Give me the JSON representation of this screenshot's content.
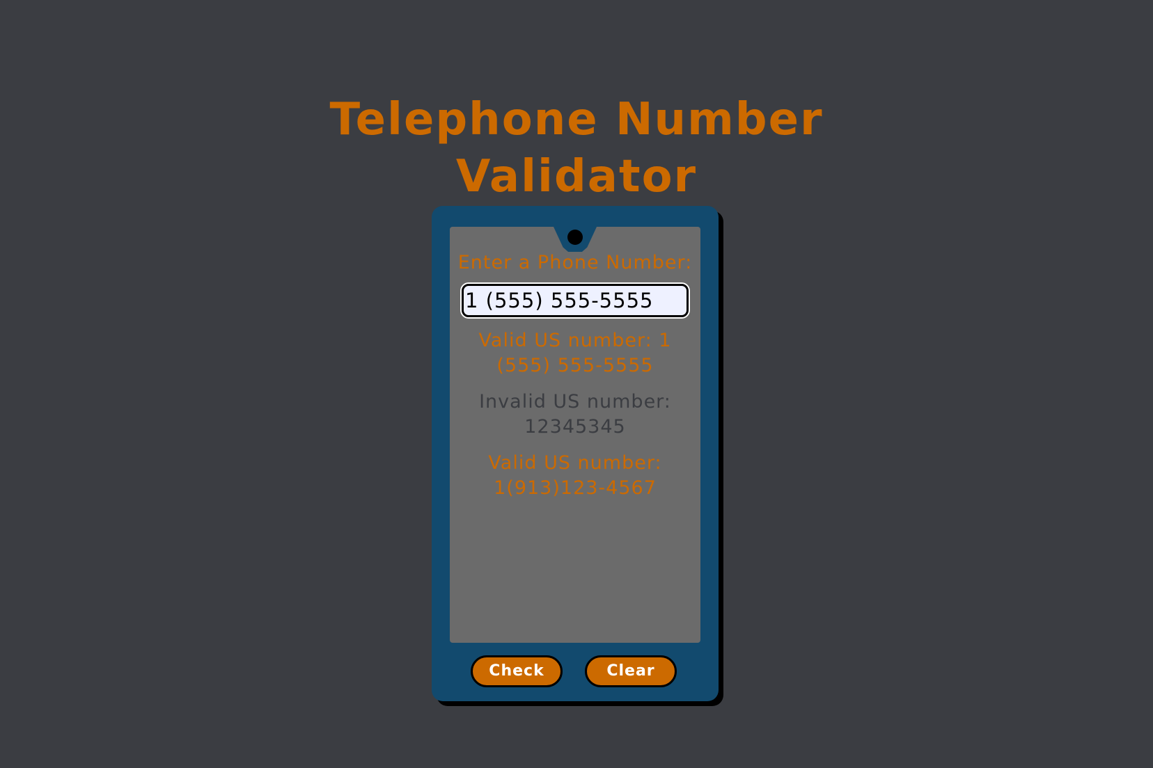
{
  "header": {
    "title_line1": "Telephone Number",
    "title_line2": "Validator"
  },
  "phone": {
    "prompt": "Enter a Phone Number:",
    "input": {
      "value": "1 (555) 555-5555",
      "placeholder": ""
    },
    "results": [
      {
        "text": "Valid US number: 1 (555) 555-5555",
        "status": "valid"
      },
      {
        "text": "Invalid US number: 12345345",
        "status": "invalid"
      },
      {
        "text": "Valid US number: 1(913)123-4567",
        "status": "valid"
      }
    ],
    "buttons": {
      "check_label": "Check",
      "clear_label": "Clear"
    }
  },
  "colors": {
    "background": "#3b3d42",
    "accent": "#cc6a00",
    "phone_body": "#124a6e",
    "screen": "#6b6b6b"
  }
}
